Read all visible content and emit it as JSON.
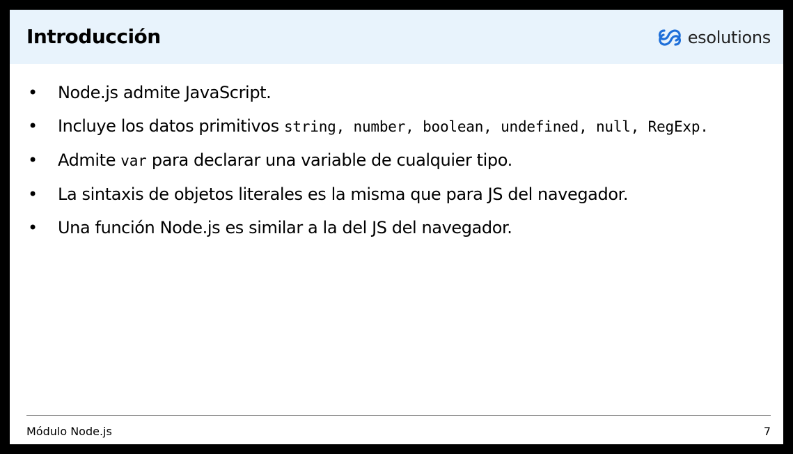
{
  "header": {
    "title": "Introducción",
    "logo_text": "esolutions",
    "logo_color": "#1e6fd9"
  },
  "bullets": [
    {
      "text": "Node.js admite JavaScript."
    },
    {
      "text_before": "Incluye los datos primitivos ",
      "types": [
        "string",
        "number",
        "boolean",
        "undefined",
        "null",
        "RegExp"
      ]
    },
    {
      "text_before": "Admite ",
      "code": "var",
      "text_after": " para declarar una variable de cualquier tipo."
    },
    {
      "text": "La sintaxis de objetos literales es la misma que para JS del navegador."
    },
    {
      "text": "Una función Node.js es similar a la del JS del navegador."
    }
  ],
  "footer": {
    "left": "Módulo Node.js",
    "page": "7"
  },
  "bullet_symbol": "•"
}
